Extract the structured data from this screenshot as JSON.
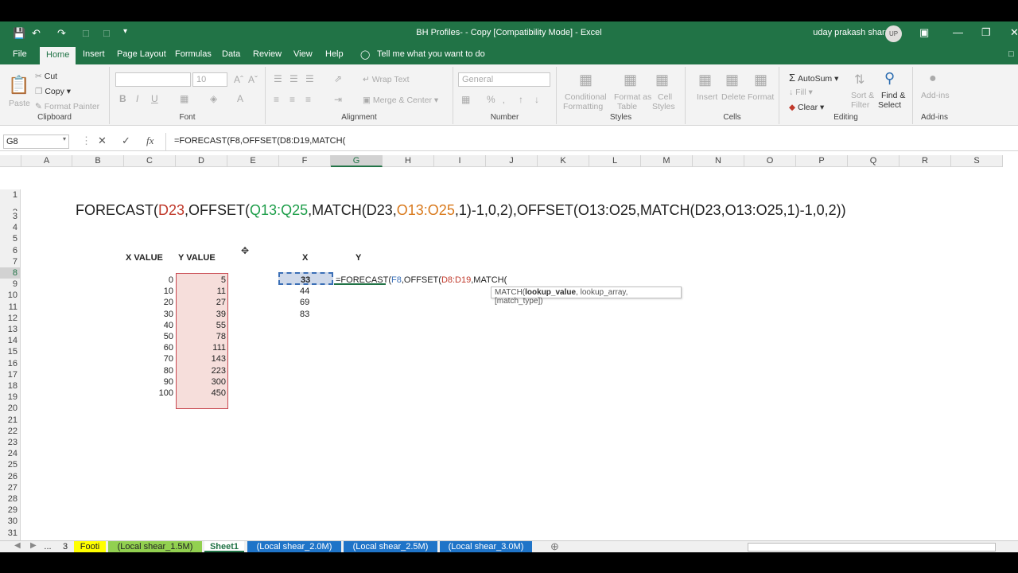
{
  "window": {
    "title": "BH Profiles- - Copy  [Compatibility Mode]  -  Excel",
    "user": "uday prakash sharma",
    "initials": "UP"
  },
  "tabs": [
    "File",
    "Home",
    "Insert",
    "Page Layout",
    "Formulas",
    "Data",
    "Review",
    "View",
    "Help"
  ],
  "tell_me": "Tell me what you want to do",
  "ribbon": {
    "clipboard": {
      "paste": "Paste",
      "cut": "Cut",
      "copy": "Copy",
      "format_painter": "Format Painter",
      "label": "Clipboard"
    },
    "font": {
      "size": "10",
      "label": "Font",
      "bold": "B",
      "italic": "I",
      "underline": "U"
    },
    "alignment": {
      "wrap": "Wrap Text",
      "merge": "Merge & Center",
      "label": "Alignment"
    },
    "number": {
      "format": "General",
      "percent": "%",
      "label": "Number"
    },
    "styles": {
      "conditional": "Conditional",
      "conditional2": "Formatting",
      "format_table": "Format as",
      "format_table2": "Table",
      "cell_styles": "Cell",
      "cell_styles2": "Styles",
      "label": "Styles"
    },
    "cells": {
      "insert": "Insert",
      "delete": "Delete",
      "format": "Format",
      "label": "Cells"
    },
    "editing": {
      "autosum": "AutoSum",
      "fill": "Fill",
      "clear": "Clear",
      "sort": "Sort &",
      "sort2": "Filter",
      "find": "Find &",
      "find2": "Select",
      "label": "Editing"
    },
    "addins": {
      "btn": "Add-ins",
      "label": "Add-ins"
    }
  },
  "namebox": "G8",
  "formula_bar": "=FORECAST(F8,OFFSET(D8:D19,MATCH(",
  "columns": [
    "A",
    "B",
    "C",
    "D",
    "E",
    "F",
    "G",
    "H",
    "I",
    "J",
    "K",
    "L",
    "M",
    "N",
    "O",
    "P",
    "Q",
    "R",
    "S"
  ],
  "rows": [
    "1",
    "2",
    "3",
    "4",
    "5",
    "6",
    "7",
    "8",
    "9",
    "10",
    "11",
    "12",
    "13",
    "14",
    "15",
    "16",
    "17",
    "18",
    "19",
    "20",
    "21",
    "22",
    "23",
    "24",
    "25",
    "26",
    "27",
    "28",
    "29",
    "30",
    "31",
    "32"
  ],
  "big_formula": {
    "p1": "FORECAST(",
    "p2": "D23",
    "p3": ",OFFSET(",
    "p4": "Q13:Q25",
    "p5": ",MATCH(D23,",
    "p6": "O13:O25",
    "p7": ",1)-1,0,2),OFFSET(O13:O25,MATCH(D23,O13:O25,1)-1,0,2))"
  },
  "headers": {
    "x_value": "X VALUE",
    "y_value": "Y VALUE",
    "x": "X",
    "y": "Y"
  },
  "x_values": [
    "0",
    "10",
    "20",
    "30",
    "40",
    "50",
    "60",
    "70",
    "80",
    "90",
    "100"
  ],
  "y_values": [
    "5",
    "11",
    "27",
    "39",
    "55",
    "78",
    "111",
    "143",
    "223",
    "300",
    "450"
  ],
  "f_values": [
    "33",
    "44",
    "69",
    "83"
  ],
  "edit": {
    "p1": "=FORECAST(",
    "p2": "F8",
    "p3": ",OFFSET(",
    "p4": "D8:D19",
    "p5": ",MATCH("
  },
  "tooltip": {
    "fn": "MATCH(",
    "arg": "lookup_value",
    "rest": ", lookup_array, [match_type])"
  },
  "sheets": [
    "...",
    "3",
    "Footi",
    "(Local shear_1.5M)",
    "Sheet1",
    "(Local shear_2.0M)",
    "(Local shear_2.5M)",
    "(Local shear_3.0M)"
  ],
  "colors": {
    "excel_green": "#217346",
    "tab_yellow": "#ffff00",
    "tab_green": "#92d050",
    "tab_blue": "#1f74c8"
  }
}
